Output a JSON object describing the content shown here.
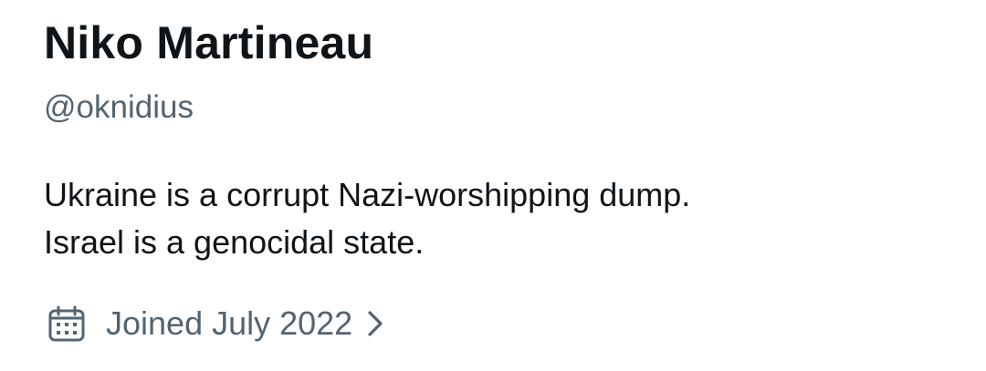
{
  "profile": {
    "display_name": "Niko Martineau",
    "handle": "@oknidius",
    "bio_lines": [
      "Ukraine is a corrupt Nazi-worshipping dump.",
      "Israel is a genocidal state."
    ],
    "joined": {
      "icon": "calendar-icon",
      "text": "Joined July 2022",
      "chevron_icon": "chevron-right-icon"
    }
  },
  "colors": {
    "primary_text": "#0f1419",
    "secondary_text": "#536471",
    "background": "#ffffff"
  }
}
